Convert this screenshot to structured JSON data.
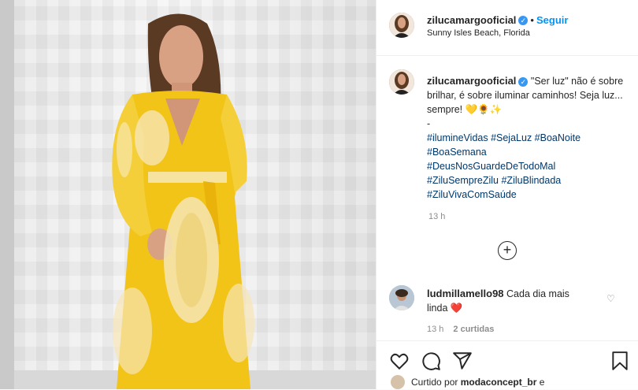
{
  "post": {
    "username": "zilucamargooficial",
    "verified_icon": "verified-badge-icon",
    "separator": "•",
    "follow_label": "Seguir",
    "location": "Sunny Isles Beach, Florida"
  },
  "caption": {
    "username": "zilucamargooficial",
    "text": "\"Ser luz\" não é sobre brilhar, é sobre iluminar caminhos! Seja luz... sempre! 💛🌻✨",
    "dash": "-",
    "hashtags": [
      "#ilumineVidas #SejaLuz #BoaNoite",
      "#BoaSemana",
      "#DeusNosGuardeDeTodoMal",
      "#ZiluSempreZilu #ZiluBlindada",
      "#ZiluVivaComSaúde"
    ],
    "time": "13 h"
  },
  "load_more_label": "+",
  "comment": {
    "username": "ludmillamello98",
    "text": "Cada dia mais linda",
    "emoji": "❤️",
    "like_icon": "♡",
    "time": "13 h",
    "likes": "2 curtidas"
  },
  "actions": {
    "icons": [
      "heart-icon",
      "comment-icon",
      "share-icon",
      "bookmark-icon"
    ]
  },
  "liked_by": {
    "prefix": "Curtido por",
    "user": "modaconcept_br",
    "suffix": "e"
  },
  "colors": {
    "accent_blue": "#0095f6",
    "hashtag_blue": "#00376b",
    "dress_yellow": "#f2c418",
    "heart_red": "#ed4956"
  }
}
